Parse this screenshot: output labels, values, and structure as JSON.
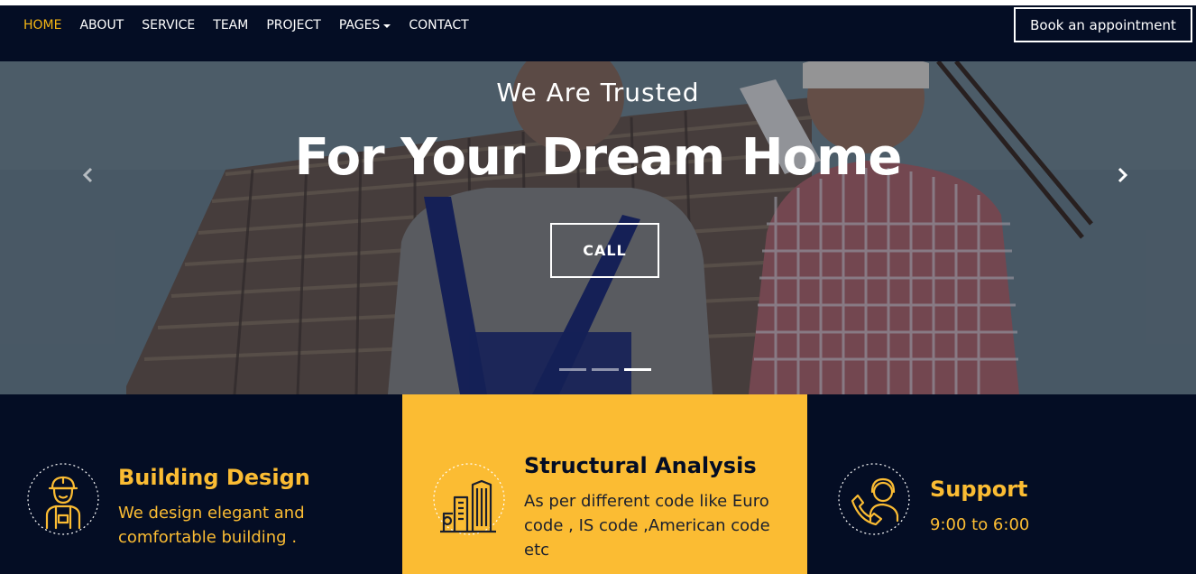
{
  "nav": {
    "items": [
      {
        "label": "HOME",
        "active": true
      },
      {
        "label": "ABOUT"
      },
      {
        "label": "SERVICE"
      },
      {
        "label": "TEAM"
      },
      {
        "label": "PROJECT"
      },
      {
        "label": "PAGES",
        "dropdown": true
      },
      {
        "label": "CONTACT"
      }
    ],
    "cta_label": "Book an appointment"
  },
  "hero": {
    "subtitle": "We Are Trusted",
    "title": "For Your Dream Home",
    "button_label": "CALL",
    "slide_count": 3,
    "active_slide": 3,
    "prev_icon": "chevron-left-icon",
    "next_icon": "chevron-right-icon"
  },
  "features": [
    {
      "title": "Building Design",
      "description": "We design elegant and comfortable building .",
      "icon": "builder-worker-icon"
    },
    {
      "title": "Structural Analysis",
      "description": "As per different code like Euro code , IS code ,American code etc",
      "icon": "city-buildings-icon"
    },
    {
      "title": "Support",
      "description": "9:00 to 6:00",
      "icon": "support-agent-icon"
    }
  ],
  "colors": {
    "navy": "#040d24",
    "accent": "#fbbc33",
    "nav_active": "#f7b614"
  }
}
